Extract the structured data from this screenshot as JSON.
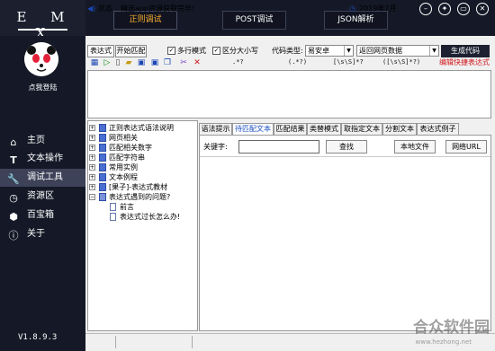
{
  "app": {
    "brand": "E M X",
    "version": "V1.8.9.3"
  },
  "top_tabs": [
    "正则调试",
    "POST调试",
    "JSON解析"
  ],
  "window_buttons": [
    "minimize-icon",
    "skin-icon",
    "restore-icon",
    "close-icon"
  ],
  "user": {
    "login": "点我登陆"
  },
  "nav": [
    {
      "label": "主页",
      "icon": "home-icon"
    },
    {
      "label": "文本操作",
      "icon": "text-icon"
    },
    {
      "label": "调试工具",
      "icon": "wrench-icon"
    },
    {
      "label": "资源区",
      "icon": "clock-icon"
    },
    {
      "label": "百宝箱",
      "icon": "hexagon-icon"
    },
    {
      "label": "关于",
      "icon": "info-icon"
    }
  ],
  "toolbar": {
    "expression_label": "表达式",
    "start_match": "开始匹配",
    "multiline": "多行模式",
    "case_sensitive": "区分大小写",
    "code_type_label": "代码类型:",
    "code_type_value": "易安卓",
    "capture_value": "返回网页数据",
    "generate": "生成代码",
    "quick_edit": "编辑快捷表达式"
  },
  "regex_shortcuts": [
    ".*?",
    "(.*?)",
    "[\\s\\S]*?",
    "([\\s\\S]*?)"
  ],
  "tree": [
    {
      "label": "正则表达式语法说明",
      "level": 0,
      "expanded": false
    },
    {
      "label": "网页相关",
      "level": 0,
      "expanded": false
    },
    {
      "label": "匹配相关数字",
      "level": 0,
      "expanded": false
    },
    {
      "label": "匹配字符串",
      "level": 0,
      "expanded": false
    },
    {
      "label": "常用实例",
      "level": 0,
      "expanded": false
    },
    {
      "label": "文本例程",
      "level": 0,
      "expanded": false
    },
    {
      "label": "[果子]-表达式教材",
      "level": 0,
      "expanded": false
    },
    {
      "label": "表达式遇到的问题?",
      "level": 0,
      "expanded": true
    },
    {
      "label": "前言",
      "level": 1
    },
    {
      "label": "表达式过长怎么办!",
      "level": 1
    }
  ],
  "right_tabs": [
    "语法提示",
    "待匹配文本",
    "匹配结果",
    "类替模式",
    "取指定文本",
    "分割文本",
    "表达式例子"
  ],
  "search": {
    "keyword_label": "关键字:",
    "keyword_value": "",
    "find": "查找",
    "local_file": "本地文件",
    "web_url": "网络URL"
  },
  "status": {
    "label": "状态",
    "message": "精选app资源获取完毕!",
    "date": "2019年7月",
    "watermark": "合众软件园",
    "watermark_url": "www.hezhong.net"
  }
}
